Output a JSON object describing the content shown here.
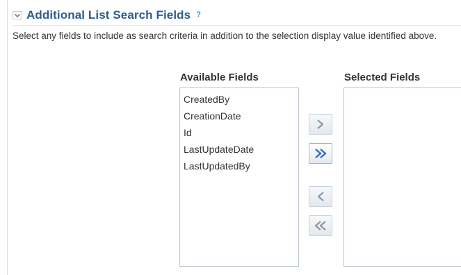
{
  "section": {
    "title": "Additional List Search Fields",
    "help_glyph": "?",
    "description": "Select any fields to include as search criteria in addition to the selection display value identified above."
  },
  "available": {
    "label": "Available Fields",
    "items": [
      "CreatedBy",
      "CreationDate",
      "Id",
      "LastUpdateDate",
      "LastUpdatedBy"
    ]
  },
  "selected": {
    "label": "Selected Fields",
    "items": []
  },
  "icons": {
    "disclosure": "chevron-down-icon",
    "help": "help-icon",
    "move": "move-right-icon",
    "move_all": "move-all-right-icon",
    "remove": "move-left-icon",
    "remove_all": "move-all-left-icon"
  },
  "colors": {
    "title": "#2c5d92",
    "help": "#4b87c3",
    "active_arrow": "#2f6fc6",
    "disabled_arrow": "#8f98a3"
  }
}
